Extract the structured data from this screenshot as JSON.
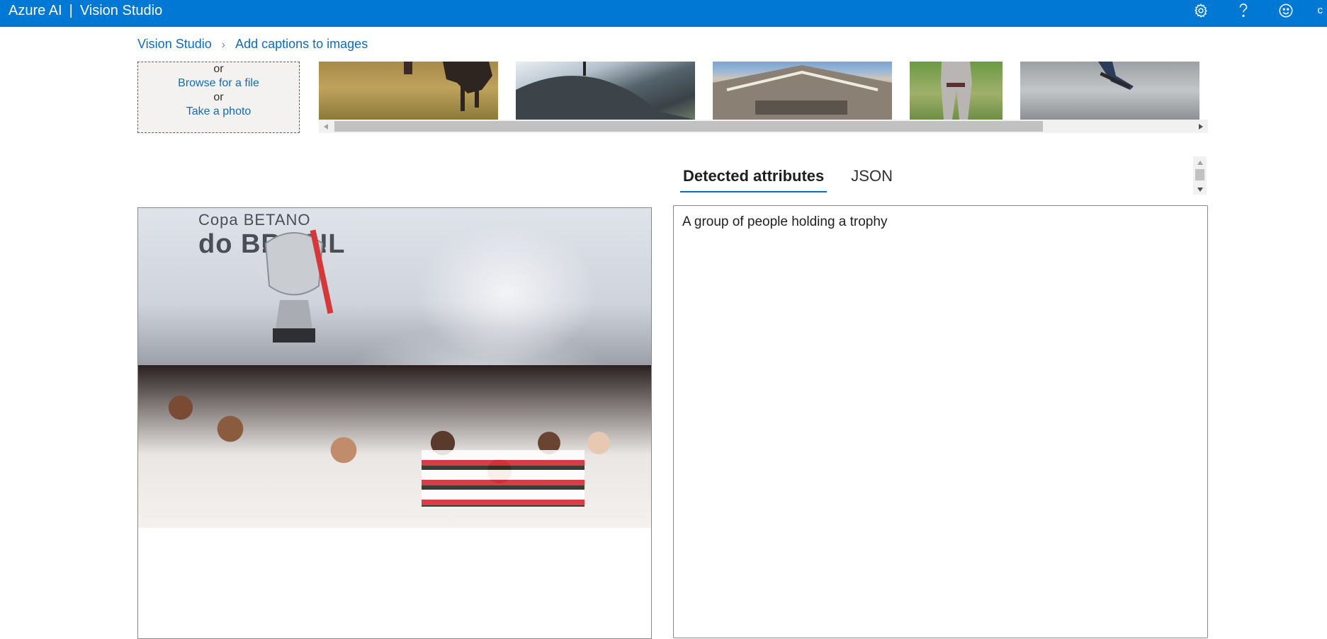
{
  "app": {
    "brand": "Azure AI",
    "separator": "|",
    "product": "Vision Studio",
    "truncated_user_initial": "c"
  },
  "header_icons": [
    "gear-icon",
    "help-icon",
    "smiley-feedback-icon"
  ],
  "breadcrumb": {
    "items": [
      "Vision Studio",
      "Add captions to images"
    ]
  },
  "upload": {
    "or_1": "or",
    "browse_label": "Browse for a file",
    "or_2": "or",
    "photo_label": "Take a photo"
  },
  "thumbnails": [
    "cow grazing in field",
    "person on rocky coast",
    "ornate building facade",
    "baseball batter",
    "skateboarder jumping"
  ],
  "tabs": {
    "items": [
      {
        "label": "Detected attributes",
        "active": true
      },
      {
        "label": "JSON",
        "active": false
      }
    ]
  },
  "result": {
    "caption": "A group of people holding a trophy"
  },
  "photo": {
    "sign_line1": "Copa BETANO",
    "sign_line2": "do BRASIL"
  },
  "colors": {
    "header_bg": "#0078d4",
    "link": "#0f6cbd",
    "tab_underline": "#0f6cbd"
  }
}
